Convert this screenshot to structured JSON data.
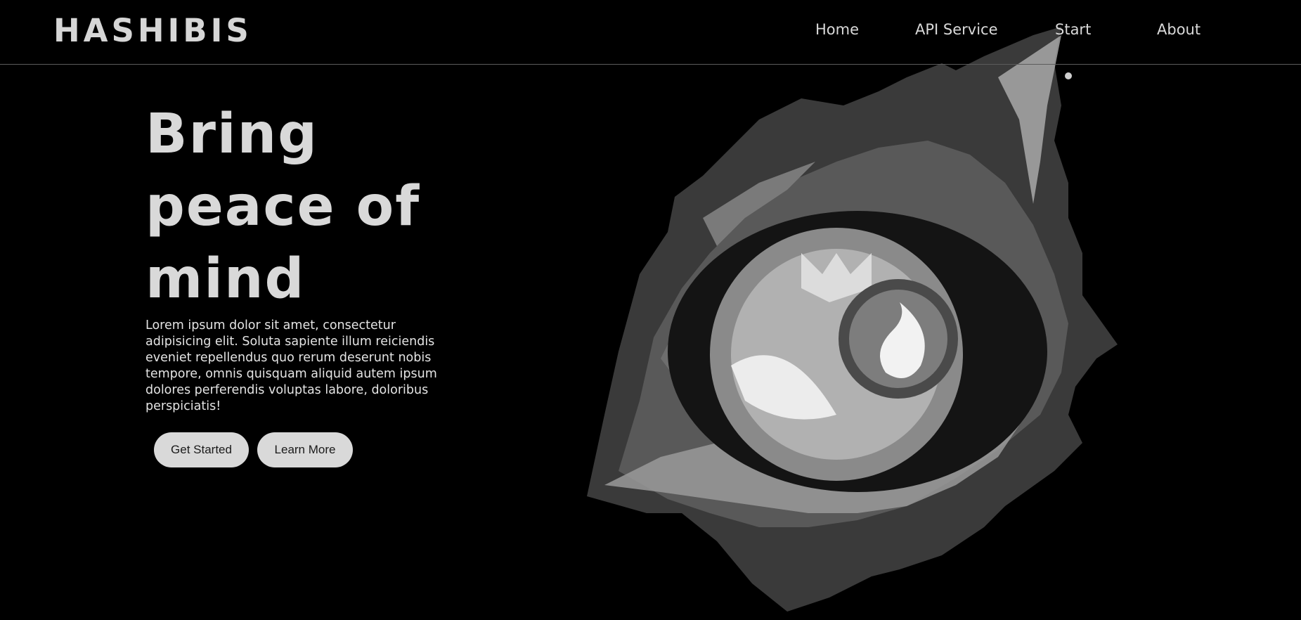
{
  "header": {
    "logo": "HASHIBIS",
    "nav": [
      {
        "label": "Home"
      },
      {
        "label": "API Service"
      },
      {
        "label": "Start"
      },
      {
        "label": "About"
      }
    ]
  },
  "hero": {
    "title_lines": [
      "Bring",
      "peace of",
      "mind"
    ],
    "description": "Lorem ipsum dolor sit amet, consectetur adipisicing elit. Soluta sapiente illum reiciendis eveniet repellendus quo rerum deserunt nobis tempore, omnis quisquam aliquid autem ipsum dolores perferendis voluptas labore, doloribus perspiciatis!",
    "buttons": {
      "primary": "Get Started",
      "secondary": "Learn More"
    }
  },
  "illustration": {
    "icon": "dragon-eye-illustration"
  },
  "colors": {
    "background": "#000000",
    "text": "#d9d9d9",
    "button_bg": "#d9d9d9",
    "divider": "#5c5c5c"
  }
}
